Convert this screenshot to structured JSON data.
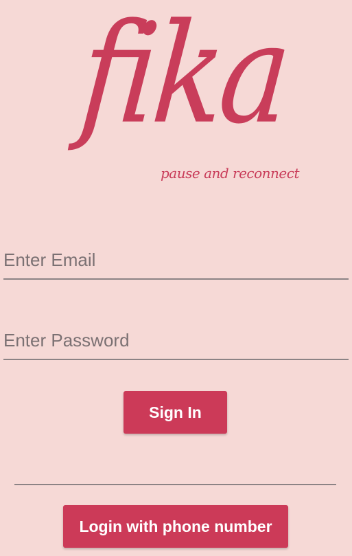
{
  "brand": {
    "logo_text": "fika",
    "tagline": "pause and reconnect",
    "color": "#c93d5a"
  },
  "form": {
    "email_placeholder": "Enter Email",
    "password_placeholder": "Enter Password"
  },
  "actions": {
    "sign_in_label": "Sign In",
    "phone_login_label": "Login with phone number",
    "button_color": "#cc3a58"
  },
  "theme": {
    "background": "#f6d9d6",
    "line_color": "#8c8385"
  }
}
